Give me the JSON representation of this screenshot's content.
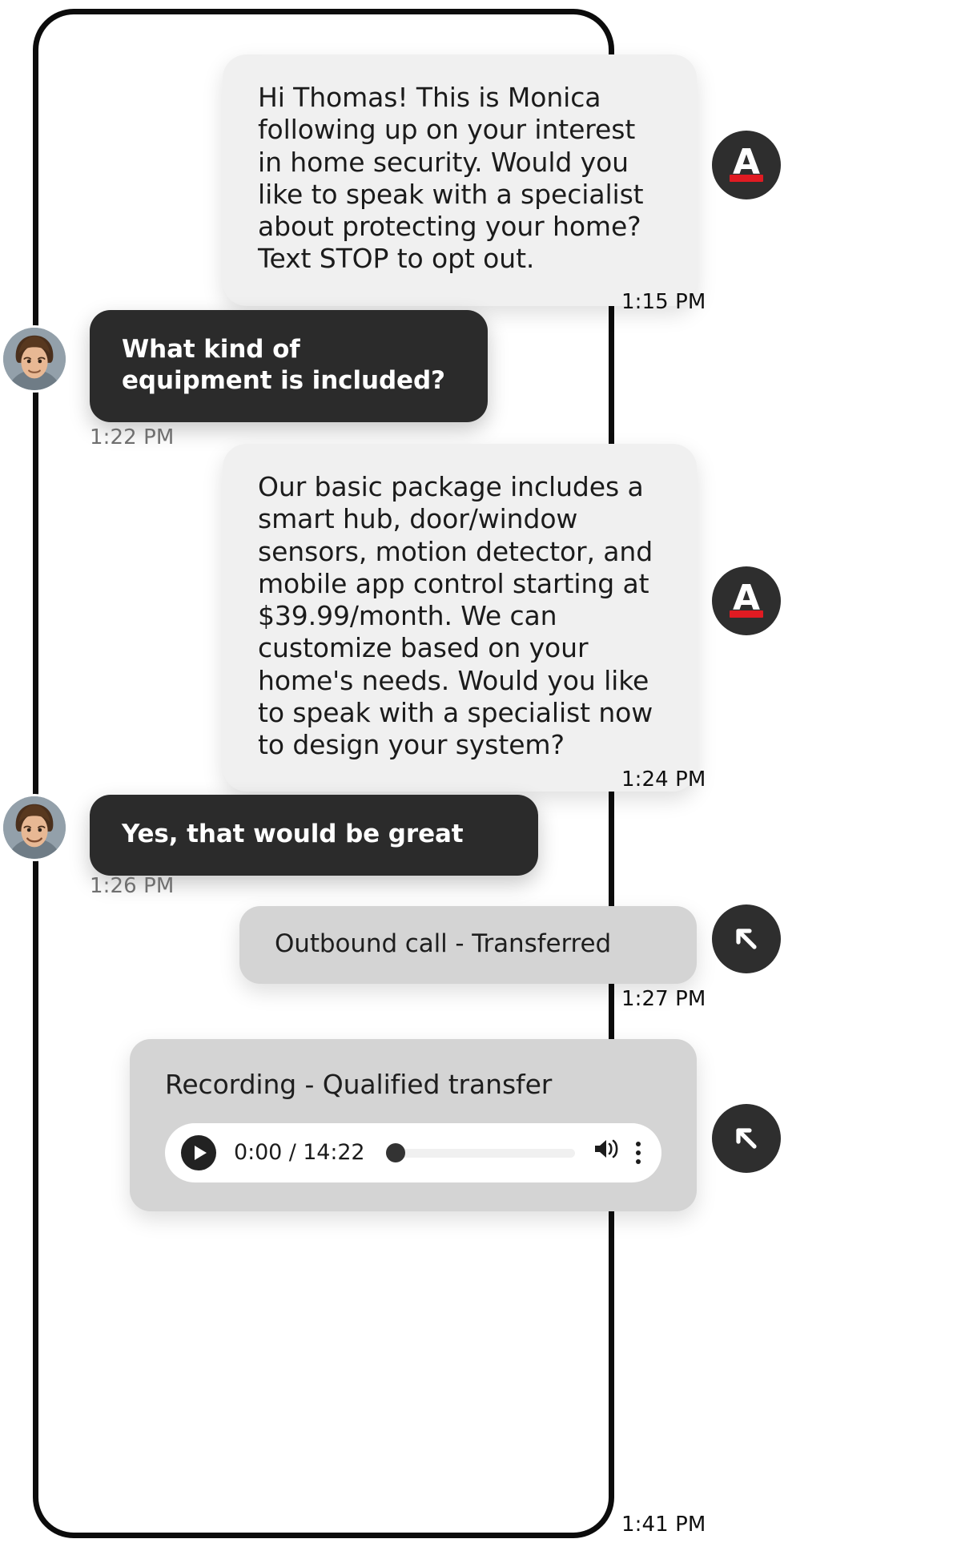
{
  "app": {
    "title": "Conversation thread",
    "brand_accent": "#e01b22",
    "panel_bg": "#ffffff",
    "agent_bubble_color": "#f0f0f0",
    "user_bubble_color": "#2b2b2b",
    "event_bubble_color": "#d4d4d4"
  },
  "messages": [
    {
      "id": "msg-1",
      "sender": "agent",
      "text": "Hi Thomas! This is Monica following up on your interest in home security. Would you like to speak with a specialist about protecting your home? Text STOP to opt out.",
      "timestamp": "1:15 PM",
      "channel_icon": "ads-a-logo-icon",
      "channel_label": "A"
    },
    {
      "id": "msg-2",
      "sender": "customer",
      "text": "What kind of equipment is included?",
      "timestamp": "1:22 PM",
      "avatar": "customer-avatar"
    },
    {
      "id": "msg-3",
      "sender": "agent",
      "text": "Our basic package includes a smart hub, door/window sensors, motion detector, and mobile app control starting at $39.99/month. We can customize based on your home's needs. Would you like to speak with a specialist now to design your system?",
      "timestamp": "1:24 PM",
      "channel_icon": "ads-a-logo-icon",
      "channel_label": "A"
    },
    {
      "id": "msg-4",
      "sender": "customer",
      "text": "Yes, that would be great",
      "timestamp": "1:26 PM",
      "avatar": "customer-avatar"
    },
    {
      "id": "msg-5",
      "sender": "event",
      "text": "Outbound call - Transferred",
      "timestamp": "1:27 PM",
      "channel_icon": "outbound-call-arrow-icon"
    },
    {
      "id": "msg-6",
      "sender": "event",
      "text": "Recording - Qualified transfer",
      "timestamp": "1:41 PM",
      "channel_icon": "outbound-call-arrow-icon",
      "audio": {
        "current_time": "0:00",
        "duration": "14:22",
        "time_display": "0:00 / 14:22",
        "progress_percent": 0,
        "play_label": "Play",
        "volume_label": "Volume",
        "menu_label": "More options"
      }
    }
  ]
}
